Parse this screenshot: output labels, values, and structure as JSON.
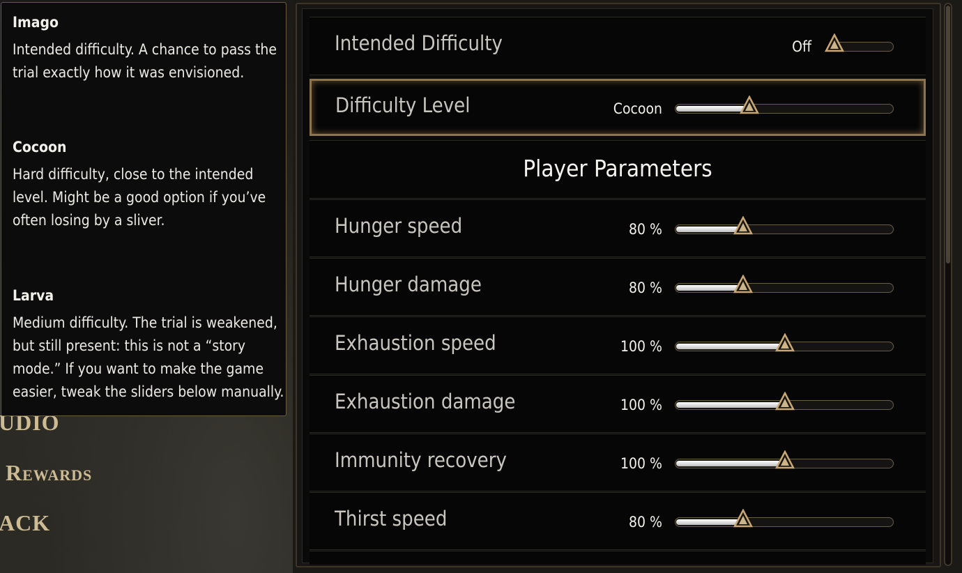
{
  "menu": {
    "audio": "UDIO",
    "rewards": "Rewards",
    "back": "ACK"
  },
  "tooltip": {
    "imago_title": "Imago",
    "imago_text": "Intended difficulty. A chance to pass the trial exactly how it was envisioned.",
    "cocoon_title": "Cocoon",
    "cocoon_text": "Hard difficulty, close to the intended level. Might be a good option if you’ve often losing by a sliver.",
    "larva_title": "Larva",
    "larva_text": "Medium difficulty. The trial is weakened, but still present: this is not a “story mode.” If you want to make the game easier, tweak the sliders below manually."
  },
  "settings": {
    "intended": {
      "label": "Intended Difficulty",
      "value": "Off",
      "level": 0.0
    },
    "difficulty": {
      "label": "Difficulty Level",
      "value": "Cocoon",
      "level": 0.33
    },
    "section_title": "Player Parameters",
    "params": [
      {
        "label": "Hunger speed",
        "value": "80 %",
        "level": 0.3
      },
      {
        "label": "Hunger damage",
        "value": "80 %",
        "level": 0.3
      },
      {
        "label": "Exhaustion speed",
        "value": "100 %",
        "level": 0.5
      },
      {
        "label": "Exhaustion damage",
        "value": "100 %",
        "level": 0.5
      },
      {
        "label": "Immunity recovery",
        "value": "100 %",
        "level": 0.5
      },
      {
        "label": "Thirst speed",
        "value": "80 %",
        "level": 0.3
      }
    ]
  },
  "colors": {
    "accent_gold": "#cdbb93",
    "selected_border": "#8a7550",
    "slider_fill": "#e6e6e6"
  }
}
